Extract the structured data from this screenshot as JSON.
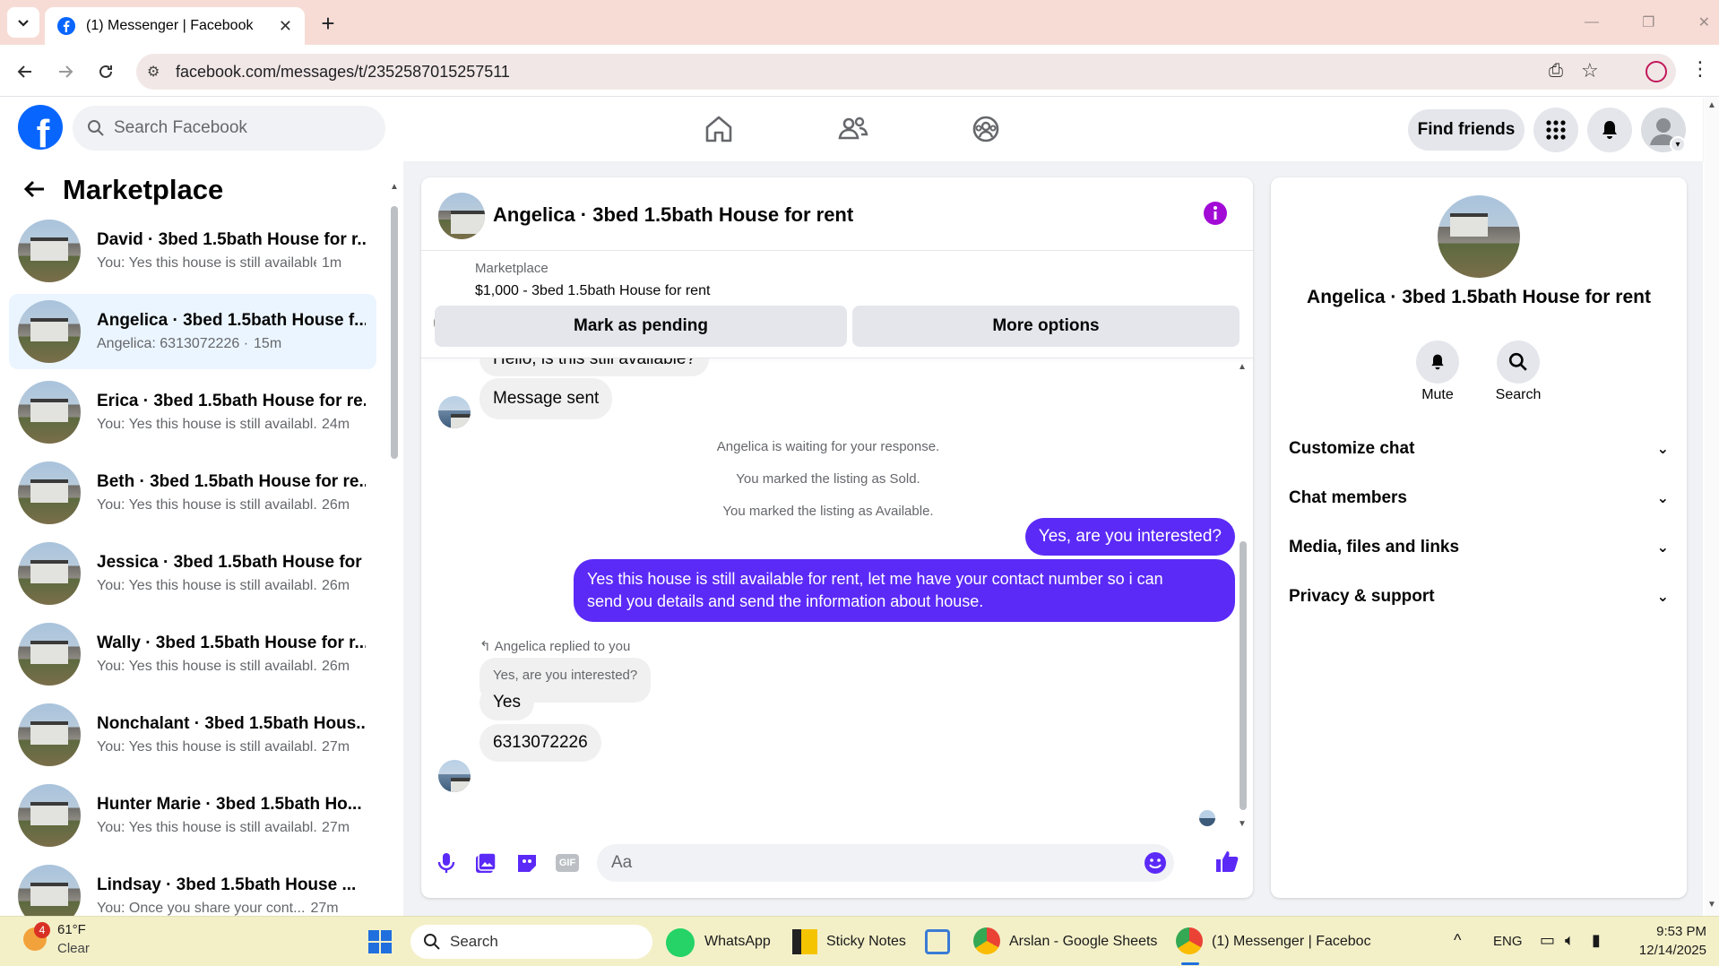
{
  "browser": {
    "tab_title": "(1) Messenger | Facebook",
    "url": "facebook.com/messages/t/2352587015257511"
  },
  "fb": {
    "search_placeholder": "Search Facebook",
    "find_friends": "Find friends"
  },
  "sidebar": {
    "title": "Marketplace",
    "conversations": [
      {
        "name": "David · 3bed 1.5bath House for r...",
        "preview": "You: Yes this house is still available ...",
        "time": "1m"
      },
      {
        "name": "Angelica · 3bed 1.5bath House f...",
        "preview": "Angelica: 6313072226 ·",
        "time": "15m"
      },
      {
        "name": "Erica · 3bed 1.5bath House for re...",
        "preview": "You: Yes this house is still availabl...",
        "time": "24m"
      },
      {
        "name": "Beth · 3bed 1.5bath House for re...",
        "preview": "You: Yes this house is still availabl...",
        "time": "26m"
      },
      {
        "name": "Jessica · 3bed 1.5bath House for ...",
        "preview": "You: Yes this house is still availabl...",
        "time": "26m"
      },
      {
        "name": "Wally · 3bed 1.5bath House for r...",
        "preview": "You: Yes this house is still availabl...",
        "time": "26m"
      },
      {
        "name": "Nonchalant · 3bed 1.5bath Hous...",
        "preview": "You: Yes this house is still availabl...",
        "time": "27m"
      },
      {
        "name": "Hunter Marie · 3bed 1.5bath Ho...",
        "preview": "You: Yes this house is still availabl...",
        "time": "27m"
      },
      {
        "name": "Lindsay · 3bed 1.5bath House ...",
        "preview": "You: Once you share your cont...",
        "time": "27m"
      }
    ]
  },
  "chat": {
    "title": "Angelica · 3bed 1.5bath House for rent",
    "listing_source": "Marketplace",
    "listing": "$1,000 - 3bed 1.5bath House for rent",
    "mark_pending": "Mark as pending",
    "more_options": "More options",
    "cut_message": "Hello, is this still available?",
    "message_sent": "Message sent",
    "system": [
      "Angelica is waiting for your response.",
      "You marked the listing as Sold.",
      "You marked the listing as Available."
    ],
    "out1": "Yes, are you interested?",
    "out2_line1": "Yes this house is still available for rent, let me have your contact number so i can",
    "out2_line2": "send you details and send the information about house.",
    "reply_note": "Angelica replied to you",
    "quoted": "Yes, are you interested?",
    "in_yes": "Yes",
    "in_phone": "6313072226",
    "composer_placeholder": "Aa"
  },
  "details": {
    "name": "Angelica · 3bed 1.5bath House for rent",
    "mute": "Mute",
    "search": "Search",
    "sections": [
      "Customize chat",
      "Chat members",
      "Media, files and links",
      "Privacy & support"
    ]
  },
  "taskbar": {
    "weather_temp": "61°F",
    "weather_desc": "Clear",
    "weather_badge": "4",
    "search": "Search",
    "apps": [
      "WhatsApp",
      "Sticky Notes",
      "Arslan - Google Sheets",
      "(1) Messenger | Faceboc"
    ],
    "lang": "ENG",
    "time": "9:53 PM",
    "date": "12/14/2025"
  },
  "colors": {
    "brand": "#0866ff",
    "outgoing": "#5b2af7",
    "info": "#a20bd6"
  }
}
